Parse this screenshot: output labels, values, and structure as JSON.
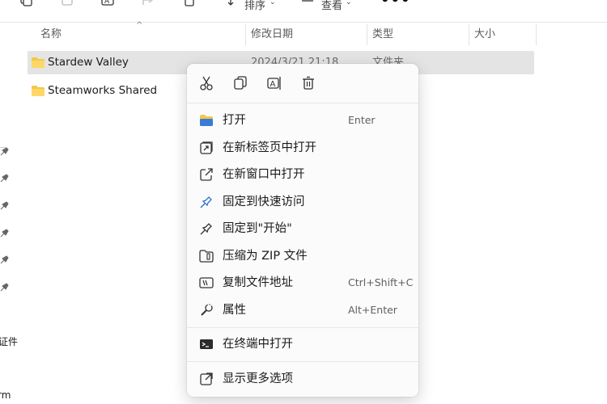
{
  "toolbar": {
    "sort_label": "排序",
    "view_label": "查看",
    "more_label": "•••"
  },
  "columns": {
    "name": "名称",
    "date": "修改日期",
    "type": "类型",
    "size": "大小"
  },
  "files": [
    {
      "name": "Stardew Valley",
      "date": "2024/3/21 21:18",
      "type": "文件夹",
      "selected": true
    },
    {
      "name": "Steamworks Shared",
      "date": "",
      "type": "",
      "selected": false
    }
  ],
  "nav": {
    "partial_text_1": "证件",
    "partial_text_2": "rm"
  },
  "context_menu": {
    "quick_actions": [
      "cut-icon",
      "copy-icon",
      "rename-icon",
      "delete-icon"
    ],
    "items": [
      {
        "label": "打开",
        "shortcut": "Enter",
        "icon": "folder-open-icon"
      },
      {
        "label": "在新标签页中打开",
        "shortcut": "",
        "icon": "new-tab-icon"
      },
      {
        "label": "在新窗口中打开",
        "shortcut": "",
        "icon": "new-window-icon"
      },
      {
        "label": "固定到快速访问",
        "shortcut": "",
        "icon": "pin-icon"
      },
      {
        "label": "固定到\"开始\"",
        "shortcut": "",
        "icon": "pin-icon"
      },
      {
        "label": "压缩为 ZIP 文件",
        "shortcut": "",
        "icon": "zip-icon"
      },
      {
        "label": "复制文件地址",
        "shortcut": "Ctrl+Shift+C",
        "icon": "copy-path-icon"
      },
      {
        "label": "属性",
        "shortcut": "Alt+Enter",
        "icon": "wrench-icon"
      },
      {
        "label": "在终端中打开",
        "shortcut": "",
        "icon": "terminal-icon"
      },
      {
        "label": "显示更多选项",
        "shortcut": "",
        "icon": "more-options-icon"
      }
    ]
  }
}
